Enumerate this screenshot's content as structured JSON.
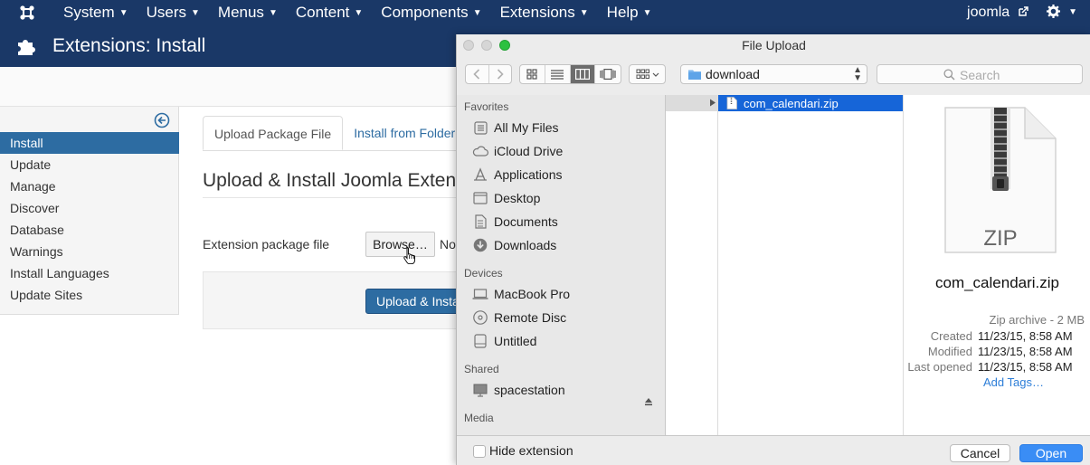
{
  "nav": {
    "brand_icon": "joomla-icon",
    "items": [
      {
        "label": "System"
      },
      {
        "label": "Users"
      },
      {
        "label": "Menus"
      },
      {
        "label": "Content"
      },
      {
        "label": "Components"
      },
      {
        "label": "Extensions"
      },
      {
        "label": "Help"
      }
    ],
    "site_link": "joomla",
    "settings_icon": "gear-icon"
  },
  "header": {
    "title": "Extensions: Install",
    "icon": "puzzle-icon"
  },
  "sidebar": {
    "items": [
      {
        "label": "Install",
        "active": true
      },
      {
        "label": "Update"
      },
      {
        "label": "Manage"
      },
      {
        "label": "Discover"
      },
      {
        "label": "Database"
      },
      {
        "label": "Warnings"
      },
      {
        "label": "Install Languages"
      },
      {
        "label": "Update Sites"
      }
    ]
  },
  "main": {
    "tabs": [
      {
        "label": "Upload Package File",
        "active": true
      },
      {
        "label": "Install from Folder"
      }
    ],
    "heading": "Upload & Install Joomla Extensio",
    "field_label": "Extension package file",
    "browse_label": "Browse…",
    "no_file_text": "No",
    "upload_button": "Upload & Insta"
  },
  "dialog": {
    "title": "File Upload",
    "location": "download",
    "search_placeholder": "Search",
    "sidebar": {
      "favorites_label": "Favorites",
      "favorites": [
        {
          "label": "All My Files",
          "icon": "all-files-icon"
        },
        {
          "label": "iCloud Drive",
          "icon": "cloud-icon"
        },
        {
          "label": "Applications",
          "icon": "applications-icon"
        },
        {
          "label": "Desktop",
          "icon": "desktop-icon"
        },
        {
          "label": "Documents",
          "icon": "documents-icon"
        },
        {
          "label": "Downloads",
          "icon": "downloads-icon"
        }
      ],
      "devices_label": "Devices",
      "devices": [
        {
          "label": "MacBook Pro",
          "icon": "laptop-icon"
        },
        {
          "label": "Remote Disc",
          "icon": "disc-icon"
        },
        {
          "label": "Untitled",
          "icon": "drive-icon"
        }
      ],
      "shared_label": "Shared",
      "shared": [
        {
          "label": "spacestation",
          "icon": "monitor-icon"
        }
      ],
      "media_label": "Media"
    },
    "selected_file": "com_calendari.zip",
    "preview": {
      "badge": "ZIP",
      "name": "com_calendari.zip",
      "kind": "Zip archive - 2 MB",
      "created_label": "Created",
      "created": "11/23/15, 8:58 AM",
      "modified_label": "Modified",
      "modified": "11/23/15, 8:58 AM",
      "last_opened_label": "Last opened",
      "last_opened": "11/23/15, 8:58 AM",
      "add_tags": "Add Tags…"
    },
    "hide_extension_label": "Hide extension",
    "cancel_label": "Cancel",
    "open_label": "Open"
  },
  "colors": {
    "navbar": "#1a3867",
    "active_blue": "#2d6ca2",
    "selection": "#1665d8",
    "open_button": "#3a8df5"
  }
}
